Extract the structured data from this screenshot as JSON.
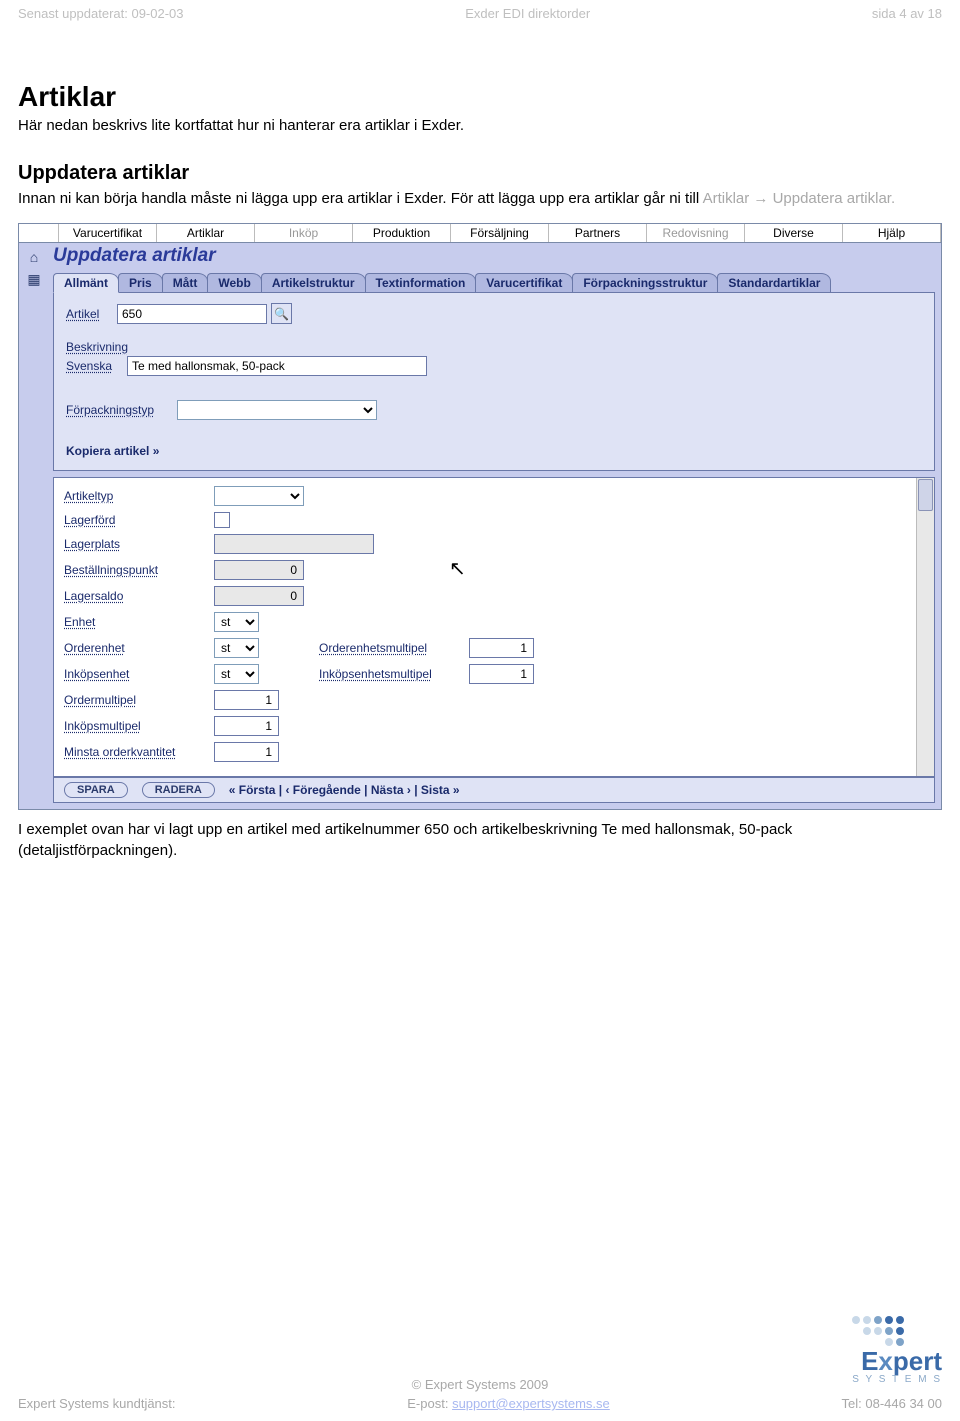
{
  "header": {
    "left": "Senast uppdaterat: 09-02-03",
    "center": "Exder EDI direktorder",
    "right": "sida 4 av 18"
  },
  "page": {
    "title": "Artiklar",
    "intro": "Här nedan beskrivs lite kortfattat hur ni hanterar era artiklar i Exder.",
    "section_title": "Uppdatera artiklar",
    "section_text_1": "Innan ni kan börja handla måste ni lägga upp era artiklar i Exder. För att lägga upp era artiklar går ni till ",
    "section_text_2": "Artiklar → Uppdatera artiklar.",
    "caption": "I exemplet ovan har vi lagt upp en artikel med artikelnummer 650 och artikelbeskrivning Te med hallonsmak, 50-pack (detaljistförpackningen)."
  },
  "menubar": {
    "items": [
      "Varucertifikat",
      "Artiklar",
      "Inköp",
      "Produktion",
      "Försäljning",
      "Partners",
      "Redovisning",
      "Diverse",
      "Hjälp"
    ],
    "disabled_idx": [
      2,
      6
    ]
  },
  "panel": {
    "title": "Uppdatera artiklar",
    "tabs": [
      "Allmänt",
      "Pris",
      "Mått",
      "Webb",
      "Artikelstruktur",
      "Textinformation",
      "Varucertifikat",
      "Förpackningsstruktur",
      "Standardartiklar"
    ],
    "active_tab": 0,
    "fields": {
      "artikel_label": "Artikel",
      "artikel_value": "650",
      "beskrivning_label": "Beskrivning",
      "svenska_label": "Svenska",
      "svenska_value": "Te med hallonsmak, 50-pack",
      "forpackningstyp_label": "Förpackningstyp",
      "kopiera_link": "Kopiera artikel »"
    },
    "subfields": {
      "artikeltyp": "Artikeltyp",
      "lagerford": "Lagerförd",
      "lagerplats": "Lagerplats",
      "bestallningspunkt": "Beställningspunkt",
      "bestallningspunkt_val": "0",
      "lagersaldo": "Lagersaldo",
      "lagersaldo_val": "0",
      "enhet": "Enhet",
      "enhet_val": "st",
      "orderenhet": "Orderenhet",
      "orderenhet_val": "st",
      "orderenhetsmultipel": "Orderenhetsmultipel",
      "orderenhetsmultipel_val": "1",
      "inkopsenhet": "Inköpsenhet",
      "inkopsenhet_val": "st",
      "inkopsenhetsmultipel": "Inköpsenhetsmultipel",
      "inkopsenhetsmultipel_val": "1",
      "ordermultipel": "Ordermultipel",
      "ordermultipel_val": "1",
      "inkopsmultipel": "Inköpsmultipel",
      "inkopsmultipel_val": "1",
      "minsta_orderkvantitet": "Minsta orderkvantitet",
      "minsta_orderkvantitet_val": "1"
    },
    "buttons": {
      "spara": "SPARA",
      "radera": "RADERA",
      "pager": "« Första  |  ‹ Föregående  |  Nästa ›  |  Sista »"
    }
  },
  "footer": {
    "copyright": "© Expert Systems 2009",
    "left": "Expert Systems kundtjänst:",
    "center_prefix": "E-post: ",
    "center_link": "support@expertsystems.se",
    "right": "Tel: 08-446 34 00",
    "logo_main": "Expert",
    "logo_sub": "S Y S T E M S"
  }
}
